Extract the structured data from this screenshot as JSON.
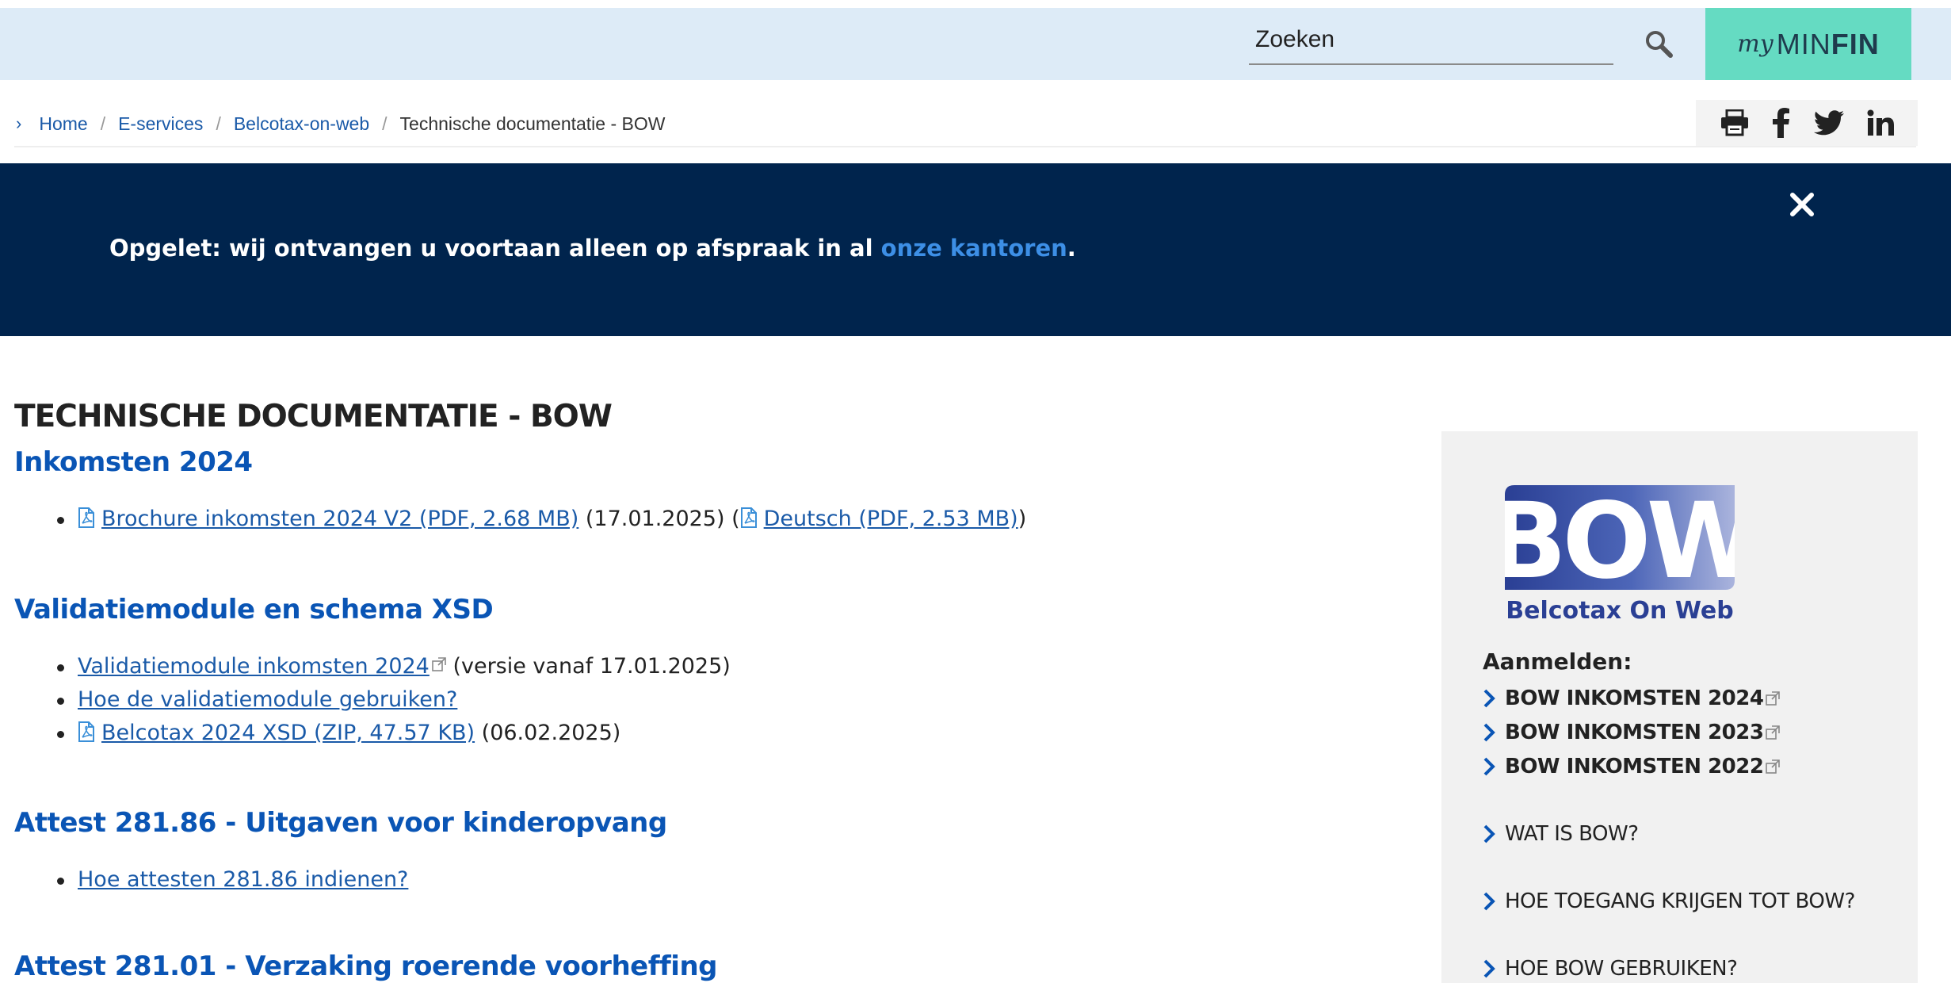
{
  "search": {
    "placeholder": "Zoeken"
  },
  "brand": {
    "my": "my",
    "min": "MIN",
    "fin": "FIN"
  },
  "breadcrumb": {
    "items": [
      "Home",
      "E-services",
      "Belcotax-on-web"
    ],
    "current": "Technische documentatie - BOW"
  },
  "alert": {
    "text": "Opgelet: wij ontvangen u voortaan alleen op afspraak in al ",
    "link": "onze kantoren",
    "end": "."
  },
  "page": {
    "title": "TECHNISCHE DOCUMENTATIE - BOW"
  },
  "sections": [
    {
      "title": "Inkomsten 2024",
      "items": [
        {
          "link": "Brochure inkomsten 2024 V2 (PDF, 2.68 MB)",
          "suffix": " (17.01.2025) (",
          "link2": "Deutsch (PDF, 2.53 MB)",
          "end": ")"
        }
      ]
    },
    {
      "title": "Validatiemodule en schema XSD",
      "items": [
        {
          "link": "Validatiemodule inkomsten 2024",
          "suffix": " (versie vanaf 17.01.2025)"
        },
        {
          "link": "Hoe de validatiemodule gebruiken?"
        },
        {
          "link": "Belcotax 2024 XSD (ZIP, 47.57 KB)",
          "suffix": " (06.02.2025)"
        }
      ]
    },
    {
      "title": "Attest 281.86 - Uitgaven voor kinderopvang",
      "items": [
        {
          "link": "Hoe attesten 281.86 indienen?"
        }
      ]
    },
    {
      "title": "Attest 281.01 - Verzaking roerende voorheffing",
      "items": []
    }
  ],
  "sidebar": {
    "logo": {
      "big": "BOW",
      "sub": "Belcotax On Web"
    },
    "heading": "Aanmelden:",
    "login_links": [
      "BOW INKOMSTEN 2024",
      "BOW INKOMSTEN 2023",
      "BOW INKOMSTEN 2022"
    ],
    "links": [
      "WAT IS BOW?",
      "HOE TOEGANG KRIJGEN TOT BOW?",
      "HOE BOW GEBRUIKEN?"
    ]
  },
  "colors": {
    "primary_blue": "#0a55b5",
    "link_blue": "#1a5aa8",
    "navy": "#00244d",
    "mint": "#65dbc2",
    "top_bg": "#ddebf7"
  }
}
